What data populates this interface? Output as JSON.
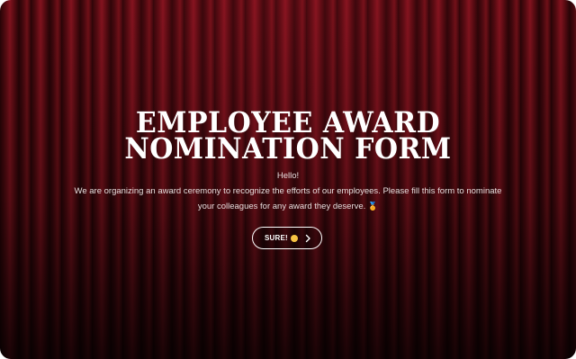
{
  "form": {
    "title_line1": "EMPLOYEE AWARD",
    "title_line2": "NOMINATION FORM",
    "greeting": "Hello!",
    "description": "We are organizing an award ceremony to recognize the efforts of our employees. Please fill this form to nominate your colleagues for any award they deserve.",
    "description_emoji": "🏅",
    "start_button": {
      "label": "SURE!",
      "emoji_icon": "grinning-face-icon",
      "arrow_icon": "chevron-right-icon"
    }
  },
  "colors": {
    "curtain_red": "#7a111b",
    "curtain_dark": "#2a0407",
    "text": "#ffffff"
  }
}
